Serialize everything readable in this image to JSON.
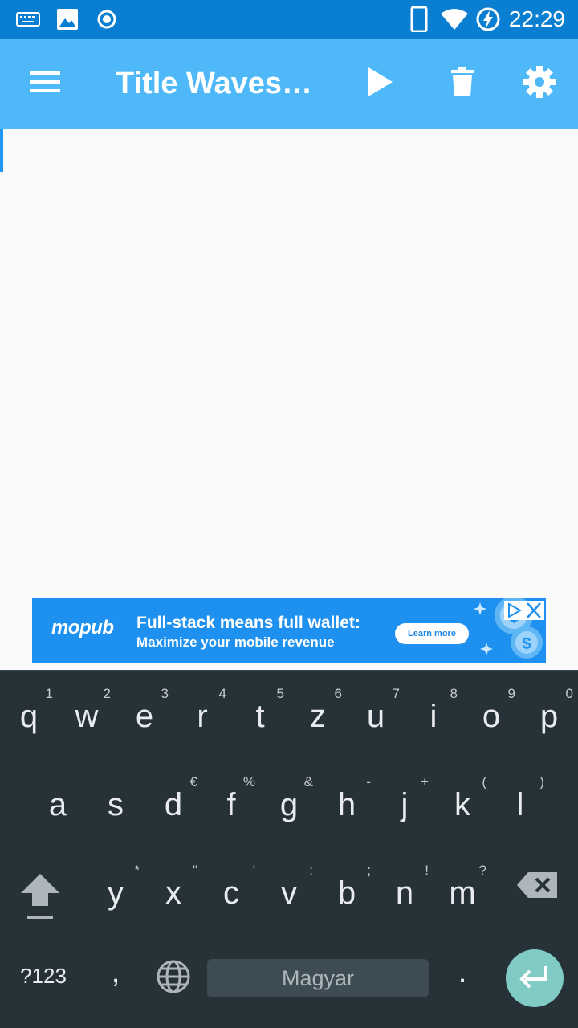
{
  "status_bar": {
    "time": "22:29",
    "icons": [
      "keyboard-icon",
      "image-icon",
      "record-icon",
      "phone-icon",
      "wifi-icon",
      "battery-charging-icon"
    ]
  },
  "app_bar": {
    "title": "Title Waves…",
    "actions": [
      "menu-icon",
      "play-icon",
      "delete-icon",
      "settings-icon"
    ]
  },
  "ad": {
    "brand": "mopub",
    "headline": "Full-stack means full wallet:",
    "subline": "Maximize your mobile revenue",
    "cta": "Learn more"
  },
  "keyboard": {
    "row1": [
      {
        "key": "q",
        "hint": "1"
      },
      {
        "key": "w",
        "hint": "2"
      },
      {
        "key": "e",
        "hint": "3"
      },
      {
        "key": "r",
        "hint": "4"
      },
      {
        "key": "t",
        "hint": "5"
      },
      {
        "key": "z",
        "hint": "6"
      },
      {
        "key": "u",
        "hint": "7"
      },
      {
        "key": "i",
        "hint": "8"
      },
      {
        "key": "o",
        "hint": "9"
      },
      {
        "key": "p",
        "hint": "0"
      }
    ],
    "row2": [
      {
        "key": "a",
        "hint": ""
      },
      {
        "key": "s",
        "hint": ""
      },
      {
        "key": "d",
        "hint": "€"
      },
      {
        "key": "f",
        "hint": "%"
      },
      {
        "key": "g",
        "hint": "&"
      },
      {
        "key": "h",
        "hint": "-"
      },
      {
        "key": "j",
        "hint": "+"
      },
      {
        "key": "k",
        "hint": "("
      },
      {
        "key": "l",
        "hint": ")"
      }
    ],
    "row3": [
      {
        "key": "y",
        "hint": "*"
      },
      {
        "key": "x",
        "hint": "\""
      },
      {
        "key": "c",
        "hint": "'"
      },
      {
        "key": "v",
        "hint": ":"
      },
      {
        "key": "b",
        "hint": ";"
      },
      {
        "key": "n",
        "hint": "!"
      },
      {
        "key": "m",
        "hint": "?"
      }
    ],
    "symbols_label": "?123",
    "comma": ",",
    "period": ".",
    "space_label": "Magyar"
  }
}
